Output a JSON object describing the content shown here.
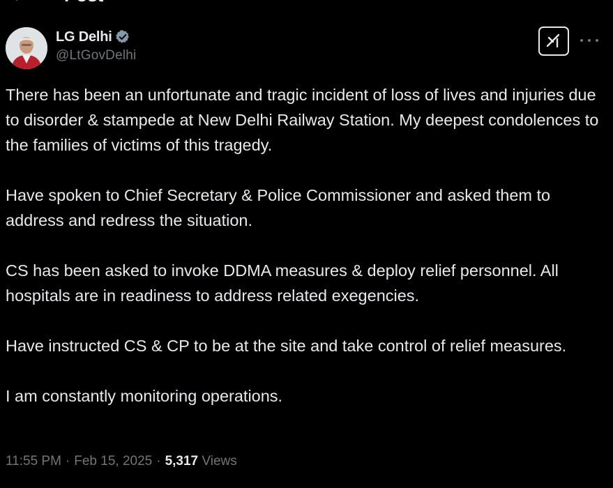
{
  "header": {
    "title": "Post"
  },
  "author": {
    "display_name": "LG Delhi",
    "handle": "@LtGovDelhi"
  },
  "tweet": {
    "paragraphs": [
      "There has been an unfortunate and tragic incident of loss of lives and injuries due to disorder & stampede at New Delhi Railway Station. My deepest condolences to the families of victims of this tragedy.",
      "Have spoken to Chief Secretary & Police Commissioner and asked them to address and redress the situation.",
      "CS has been asked to invoke DDMA measures & deploy relief personnel. All hospitals are in readiness to address related exegencies.",
      "Have instructed CS & CP to be at the site and take control of relief measures.",
      "I am constantly monitoring operations."
    ]
  },
  "meta": {
    "time": "11:55 PM",
    "separator": "·",
    "date": "Feb 15, 2025",
    "views_count": "5,317",
    "views_label": "Views"
  },
  "icons": {
    "back": "back-arrow-icon",
    "verified": "verified-badge-icon",
    "grok": "grok-icon",
    "more": "more-horizontal-icon"
  },
  "colors": {
    "background": "#000000",
    "text_primary": "#e7e9ea",
    "text_secondary": "#71767b",
    "verified_badge": "#829aab"
  }
}
